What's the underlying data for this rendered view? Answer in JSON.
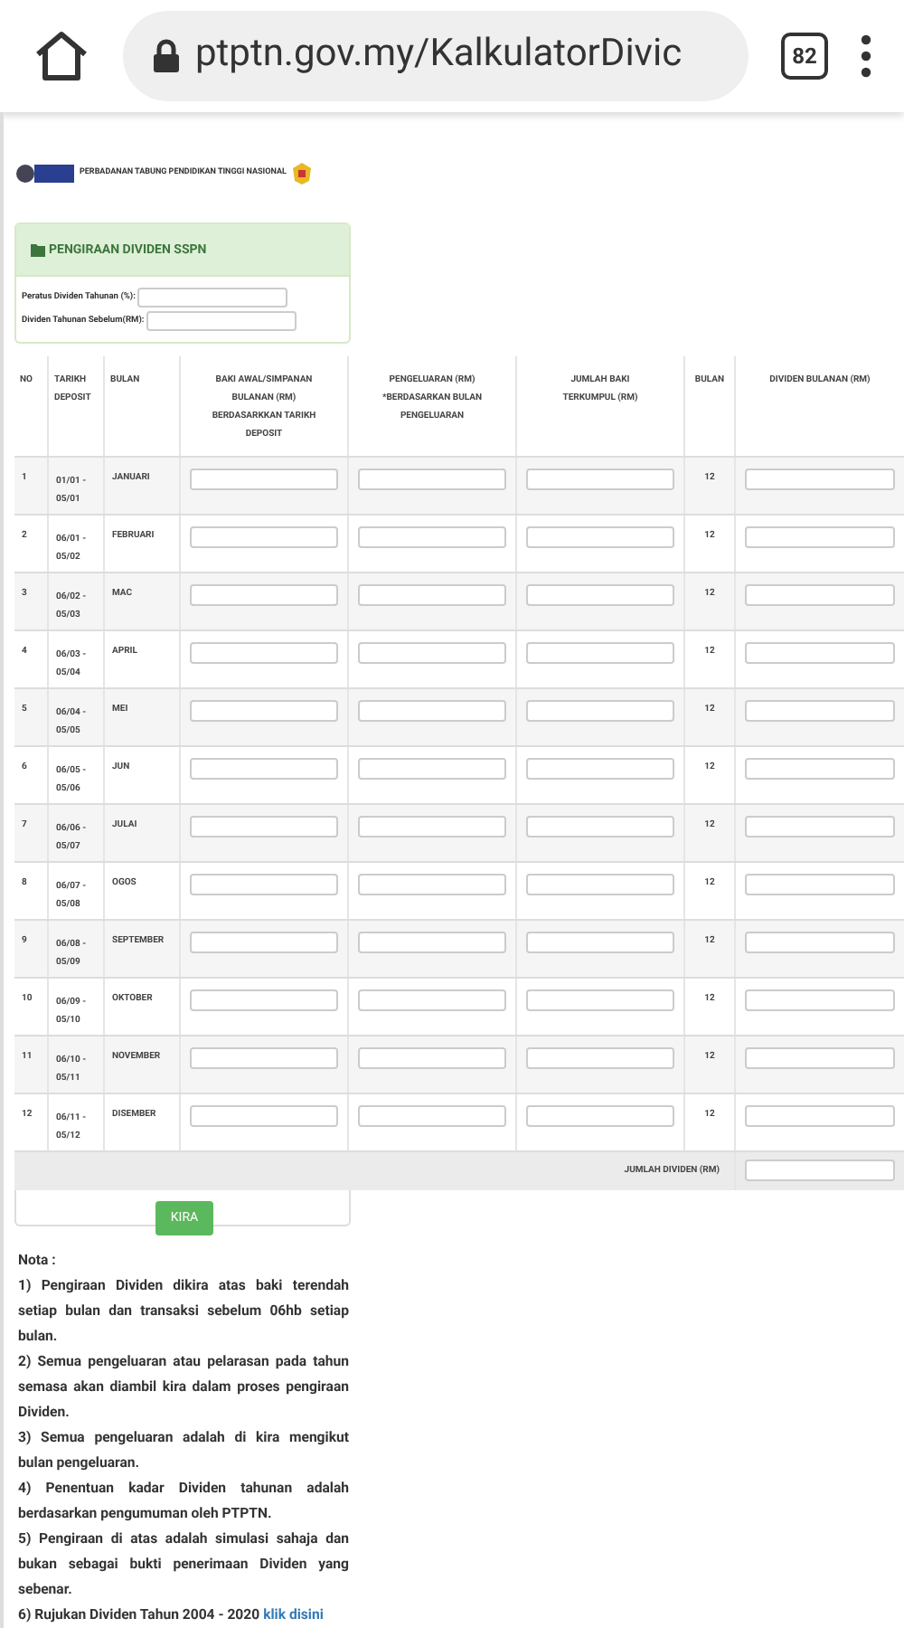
{
  "browser": {
    "url": "ptptn.gov.my/KalkulatorDivic",
    "tab_count": "82"
  },
  "header": {
    "org_name": "PERBADANAN TABUNG PENDIDIKAN TINGGI NASIONAL"
  },
  "panel": {
    "title": "PENGIRAAN DIVIDEN SSPN",
    "fields": [
      {
        "label": "Peratus Dividen Tahunan (%):"
      },
      {
        "label": "Dividen Tahunan Sebelum(RM):"
      }
    ]
  },
  "table": {
    "columns": [
      "NO",
      "TARIKH DEPOSIT",
      "BULAN",
      "BAKI AWAL/SIMPANAN BULANAN (RM) BERDASARKKAN TARIKH DEPOSIT",
      "PENGELUARAN (RM) *BERDASARKAN BULAN PENGELUARAN",
      "JUMLAH BAKI TERKUMPUL (RM)",
      "BULAN",
      "DIVIDEN BULANAN (RM)"
    ],
    "rows": [
      {
        "no": "1",
        "date": "01/01 - 05/01",
        "month": "JANUARI",
        "months": "12"
      },
      {
        "no": "2",
        "date": "06/01 - 05/02",
        "month": "FEBRUARI",
        "months": "12"
      },
      {
        "no": "3",
        "date": "06/02 - 05/03",
        "month": "MAC",
        "months": "12"
      },
      {
        "no": "4",
        "date": "06/03 - 05/04",
        "month": "APRIL",
        "months": "12"
      },
      {
        "no": "5",
        "date": "06/04 - 05/05",
        "month": "MEI",
        "months": "12"
      },
      {
        "no": "6",
        "date": "06/05 - 05/06",
        "month": "JUN",
        "months": "12"
      },
      {
        "no": "7",
        "date": "06/06 - 05/07",
        "month": "JULAI",
        "months": "12"
      },
      {
        "no": "8",
        "date": "06/07 - 05/08",
        "month": "OGOS",
        "months": "12"
      },
      {
        "no": "9",
        "date": "06/08 - 05/09",
        "month": "SEPTEMBER",
        "months": "12"
      },
      {
        "no": "10",
        "date": "06/09 - 05/10",
        "month": "OKTOBER",
        "months": "12"
      },
      {
        "no": "11",
        "date": "06/10 - 05/11",
        "month": "NOVEMBER",
        "months": "12"
      },
      {
        "no": "12",
        "date": "06/11 - 05/12",
        "month": "DISEMBER",
        "months": "12"
      }
    ],
    "total_label": "JUMLAH DIVIDEN (RM)"
  },
  "calculate_button": "KIRA",
  "notes": {
    "title": "Nota :",
    "items": [
      "1) Pengiraan Dividen dikira atas baki terendah setiap bulan dan transaksi sebelum 06hb setiap bulan.",
      "2) Semua pengeluaran atau pelarasan pada tahun semasa akan diambil kira dalam proses pengiraan Dividen.",
      "3) Semua pengeluaran adalah di kira mengikut bulan pengeluaran.",
      "4) Penentuan kadar Dividen tahunan adalah berdasarkan pengumuman oleh PTPTN.",
      "5) Pengiraan di atas adalah simulasi sahaja dan bukan sebagai bukti penerimaan Dividen yang sebenar."
    ],
    "last_item": "6) Rujukan Dividen Tahun 2004 - 2020",
    "link": "klik disini"
  }
}
